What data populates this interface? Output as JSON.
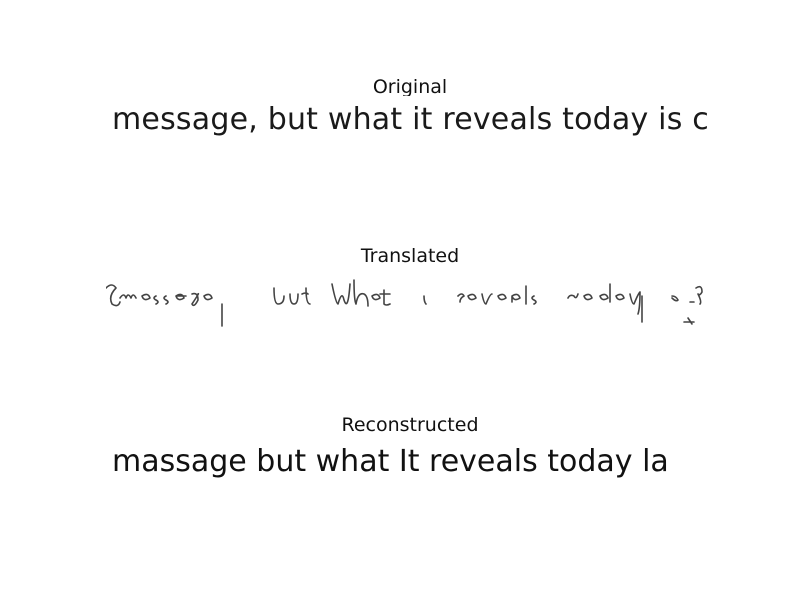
{
  "panels": {
    "original": {
      "title": "Original",
      "text": "message, but what it reveals today is c"
    },
    "translated": {
      "title": "Translated"
    },
    "reconstructed": {
      "title": "Reconstructed",
      "text": "massage but what It reveals today la"
    }
  }
}
